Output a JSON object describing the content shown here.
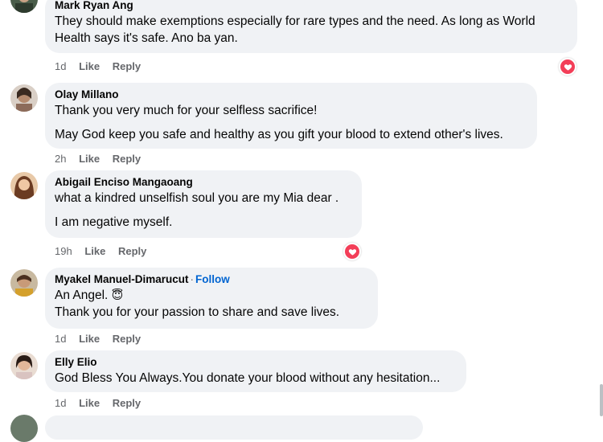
{
  "comments": [
    {
      "name": "Mark Ryan Ang",
      "lines": [
        "They should make exemptions especially for rare types and the need. As long as World",
        "Health says it's safe. Ano ba yan."
      ],
      "time": "1d",
      "like": "Like",
      "reply": "Reply",
      "reaction": "love-reaction"
    },
    {
      "name": "Olay Millano",
      "lines": [
        "Thank you very much for your selfless sacrifice!",
        "May God keep you safe and healthy as you gift your blood to extend other's lives."
      ],
      "time": "2h",
      "like": "Like",
      "reply": "Reply"
    },
    {
      "name": "Abigail Enciso Mangaoang",
      "lines": [
        "what a kindred unselfish soul you are my Mia dear .",
        "I am negative myself."
      ],
      "time": "19h",
      "like": "Like",
      "reply": "Reply",
      "reaction": "love-reaction"
    },
    {
      "name": "Myakel Manuel-Dimarucut",
      "follow": "Follow",
      "lines": [
        "An Angel.",
        "Thank you for your passion to share and save lives."
      ],
      "emoji": "😇",
      "time": "1d",
      "like": "Like",
      "reply": "Reply"
    },
    {
      "name": "Elly Elio",
      "lines": [
        "God Bless You Always.You donate your blood without any hesitation..."
      ],
      "time": "1d",
      "like": "Like",
      "reply": "Reply"
    }
  ],
  "colors": {
    "bubble": "#f0f2f5",
    "love": "#f33e58",
    "follow": "#0064d1",
    "meta": "#65676b"
  }
}
